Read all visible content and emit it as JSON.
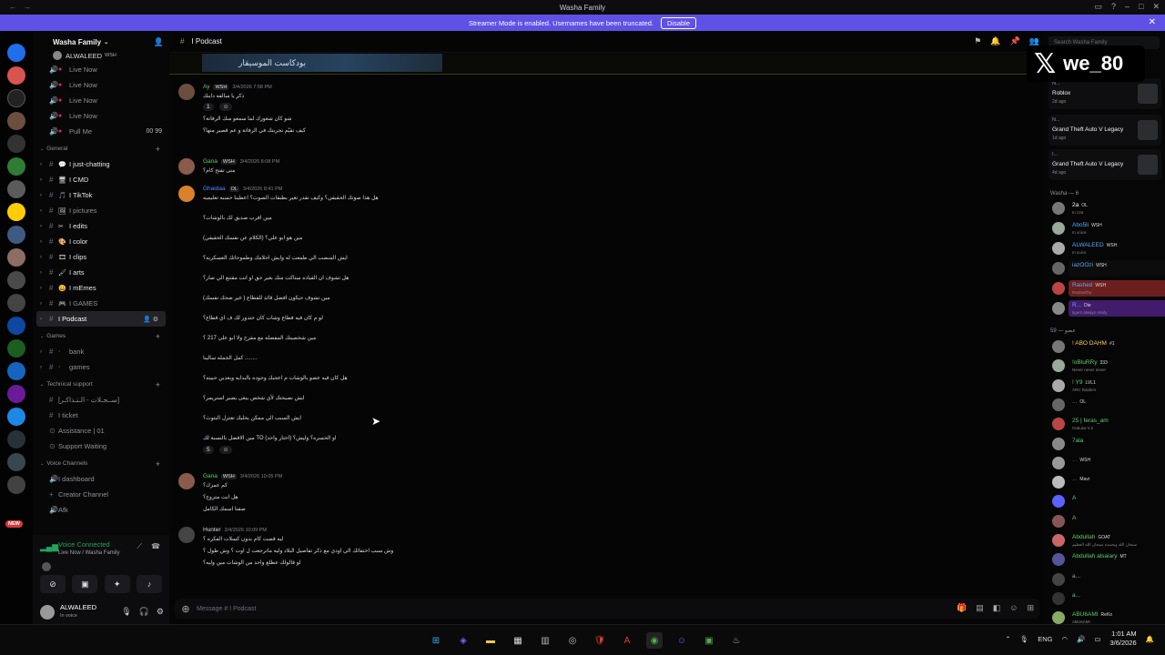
{
  "window": {
    "title": "Washa Family"
  },
  "banner": {
    "text": "Streamer Mode is enabled. Usernames have been truncated.",
    "disable_label": "Disable"
  },
  "servers": {
    "new_label": "NEW",
    "badges": [
      "1",
      "2",
      "24"
    ]
  },
  "sidebar": {
    "guild_name": "Washa Family",
    "top_user": {
      "name": "ALWALEED",
      "tag": "WSH"
    },
    "voice_top": [
      {
        "label": "Live Now"
      },
      {
        "label": "Live Now"
      },
      {
        "label": "Live Now"
      },
      {
        "label": "Live Now"
      },
      {
        "label": "Pull Me",
        "right": "00  99"
      }
    ],
    "categories": {
      "general": "General",
      "games": "Games",
      "support": "Technical support",
      "voice": "Voice Channels"
    },
    "general_channels": [
      {
        "label": "I just-chatting",
        "bright": true
      },
      {
        "label": "I CMD",
        "bright": true
      },
      {
        "label": "I TikTok",
        "bright": true
      },
      {
        "label": "I pictures",
        "bright": false
      },
      {
        "label": "I edits",
        "bright": true
      },
      {
        "label": "I color",
        "bright": true
      },
      {
        "label": "I clips",
        "bright": true
      },
      {
        "label": "I arts",
        "bright": true
      },
      {
        "label": "I mEmes",
        "bright": true
      },
      {
        "label": "I GAMES",
        "bright": false
      },
      {
        "label": "I Podcast",
        "bright": true,
        "active": true
      }
    ],
    "games_channels": [
      {
        "label": "bank"
      },
      {
        "label": "games"
      }
    ],
    "support_channels": [
      {
        "label": "[ســجـلات - الـتـذاكـر]"
      },
      {
        "label": "I ticket"
      },
      {
        "label": "Assistance | 01"
      },
      {
        "label": "Support Waiting"
      }
    ],
    "voice_channels": [
      {
        "label": "I dashboard"
      },
      {
        "label": "Creator Channel"
      },
      {
        "label": "Afk"
      }
    ]
  },
  "voice_panel": {
    "status": "Voice Connected",
    "location": "Live Now / Washa Family",
    "buttons": [
      "camera-off-icon",
      "screen-share-icon",
      "activities-icon",
      "soundboard-icon"
    ]
  },
  "user_panel": {
    "name": "ALWALEED",
    "status": "In voice"
  },
  "chat": {
    "channel": "I Podcast",
    "pinned_banner": "بودكاست الموسيقار",
    "input_placeholder": "Message #  I  Podcast",
    "messages": [
      {
        "author": "Ay",
        "tag": "WSH",
        "time": "3/4/2026 7:58 PM",
        "lines": [
          "ذكر يا سالفه داينك"
        ],
        "reactions": [
          "1"
        ],
        "extra": [
          "شو كان شعورك لما سمعو منك الرفاتة؟",
          "كيف تقيّم تجربتك في الرفاتة و عم قصير منها؟"
        ]
      },
      {
        "author": "Gana",
        "tag": "WSH",
        "time": "3/4/2026 8:08 PM",
        "lines": [
          "متى تفتح كام؟"
        ]
      },
      {
        "author": "Ghaidaa",
        "tag": "OL",
        "time": "3/4/2026 8:41 PM",
        "lines": [
          "هل هذا صوتك الحقيقي؟ وكيف تقدر تغير بطبقات الصوت؟ اعطينا حسبه تعليميه",
          "مين اقرب صديق لك بالوشات؟",
          "مين هو ابو علي؟ (الكلام عن نفسك الحقيقي)",
          "ايش المنصب الي طمعت له وايش احلامك وطموحاتك العسكريه؟",
          "هل تشوف ان القياده ستاكت منك بغير حق او انت مقتنع الي صار؟",
          "مين تشوف حيكون افضل قائد للقطاع ( غير ضحك نفسك)",
          "لو م كان فيه قطاع وشات كان حتدور لك ف اي قطاع؟",
          "مين شخصيتك المفضله مع مفرح ولا ابو علي 217 ؟",
          "كمل الجمله سالينا ........",
          "هل كان فيه عضو بالوشات م اعجبك وجوده بالبدايه وبعدين حبيته؟",
          "ايش نصيحتك لأي شخص يبغى يصير استريمر؟",
          "ايش السبب الي ممكن يخليك تعتزل البثوث؟",
          "مين الافضل بالنسبة لك TO او الحسره؟ وليش؟ (اختار واحد)"
        ],
        "edited": "(edited)",
        "reactions": [
          "5"
        ]
      },
      {
        "author": "Gana",
        "tag": "WSH",
        "time": "3/4/2026 10:05 PM",
        "lines": [
          "كم عمرك؟",
          "هل انت متزوج؟",
          "صفنا اسمك الكامل"
        ]
      },
      {
        "author": "Hunter",
        "tag": "",
        "time": "3/4/2026 10:09 PM",
        "lines": [
          "ليه قصت كام بدون كسلات الفكره ؟",
          "وش سبب اختفائك الي اودي مع ذكر تفاصيل البلاد وليه ماترجعت ل اوت ؟ وش طول ؟",
          "لو قالولك عطلع واحد من الوشات مين وليه؟"
        ]
      }
    ]
  },
  "members": {
    "search_placeholder": "Search Washa Family",
    "overlay_handle": "we_80",
    "activities": [
      {
        "user": "N...",
        "game": "Roblox",
        "time": "2d ago"
      },
      {
        "user": "N...",
        "game": "Grand Theft Auto V Legacy",
        "time": "1d ago"
      },
      {
        "user": "I...",
        "game": "Grand Theft Auto V Legacy",
        "time": "4d ago"
      }
    ],
    "group1_title": "Washa — 6",
    "group1": [
      {
        "name": "2a",
        "tag": "OL",
        "sub": "In z2a",
        "color": "#ffffff"
      },
      {
        "name": "Abo5li",
        "tag": "WSH",
        "sub": "In voice",
        "color": "#5aa9ff"
      },
      {
        "name": "ALWALEED",
        "tag": "WSH",
        "sub": "In voice",
        "color": "#5aa9ff"
      },
      {
        "name": "iazOOzi",
        "tag": "WSH",
        "sub": "",
        "color": "#5aa9ff"
      },
      {
        "name": "Rashed",
        "tag": "WSH",
        "sub": "RashedTor",
        "color": "#5aa9ff"
      },
      {
        "name": "R...",
        "tag": "Die",
        "sub": "tigers always ready",
        "color": "#5aa9ff"
      }
    ],
    "group2_title": "عضو — 59",
    "group2": [
      {
        "name": "! ABO DAHM",
        "tag": "#1",
        "sub": "",
        "color": "#ffd24a"
      },
      {
        "name": "!oBluRRy",
        "tag": "333",
        "sub": "Never never never",
        "color": "#5fd068"
      },
      {
        "name": "! Y9",
        "tag": "LVL1",
        "sub": "ARC Raiders",
        "color": "#5fd068"
      },
      {
        "name": "...",
        "tag": "OL",
        "sub": "",
        "color": "#5a62ff"
      },
      {
        "name": "25 | feras_am",
        "tag": "",
        "sub": "OutLaw V.2",
        "color": "#5fd068"
      },
      {
        "name": "7ala",
        "tag": "",
        "sub": "",
        "color": "#5fd068"
      },
      {
        "name": "...",
        "tag": "WSH",
        "sub": "",
        "color": "#c0392b"
      },
      {
        "name": "...",
        "tag": "Mavi",
        "sub": "",
        "color": "#5a62ff"
      },
      {
        "name": "A",
        "tag": "",
        "sub": "",
        "color": "#5fd068"
      },
      {
        "name": "A",
        "tag": "",
        "sub": "",
        "color": "#5fd068"
      },
      {
        "name": "Abdullah",
        "tag": "GOAT",
        "sub": "سبحان الله وبحمده سبحان الله العظيم",
        "color": "#5fd068"
      },
      {
        "name": "Abdullah alsaiary",
        "tag": "MT",
        "sub": "",
        "color": "#5fd068"
      },
      {
        "name": "a...",
        "tag": "",
        "sub": "",
        "color": "#5fd068"
      },
      {
        "name": "a...",
        "tag": "",
        "sub": "",
        "color": "#5fd068"
      },
      {
        "name": "ABU6AMI",
        "tag": "ReKo",
        "sub": "ABU6AMI",
        "color": "#5fd068"
      }
    ]
  },
  "taskbar": {
    "lang": "ENG",
    "time": "1:01 AM",
    "date": "3/6/2026"
  }
}
